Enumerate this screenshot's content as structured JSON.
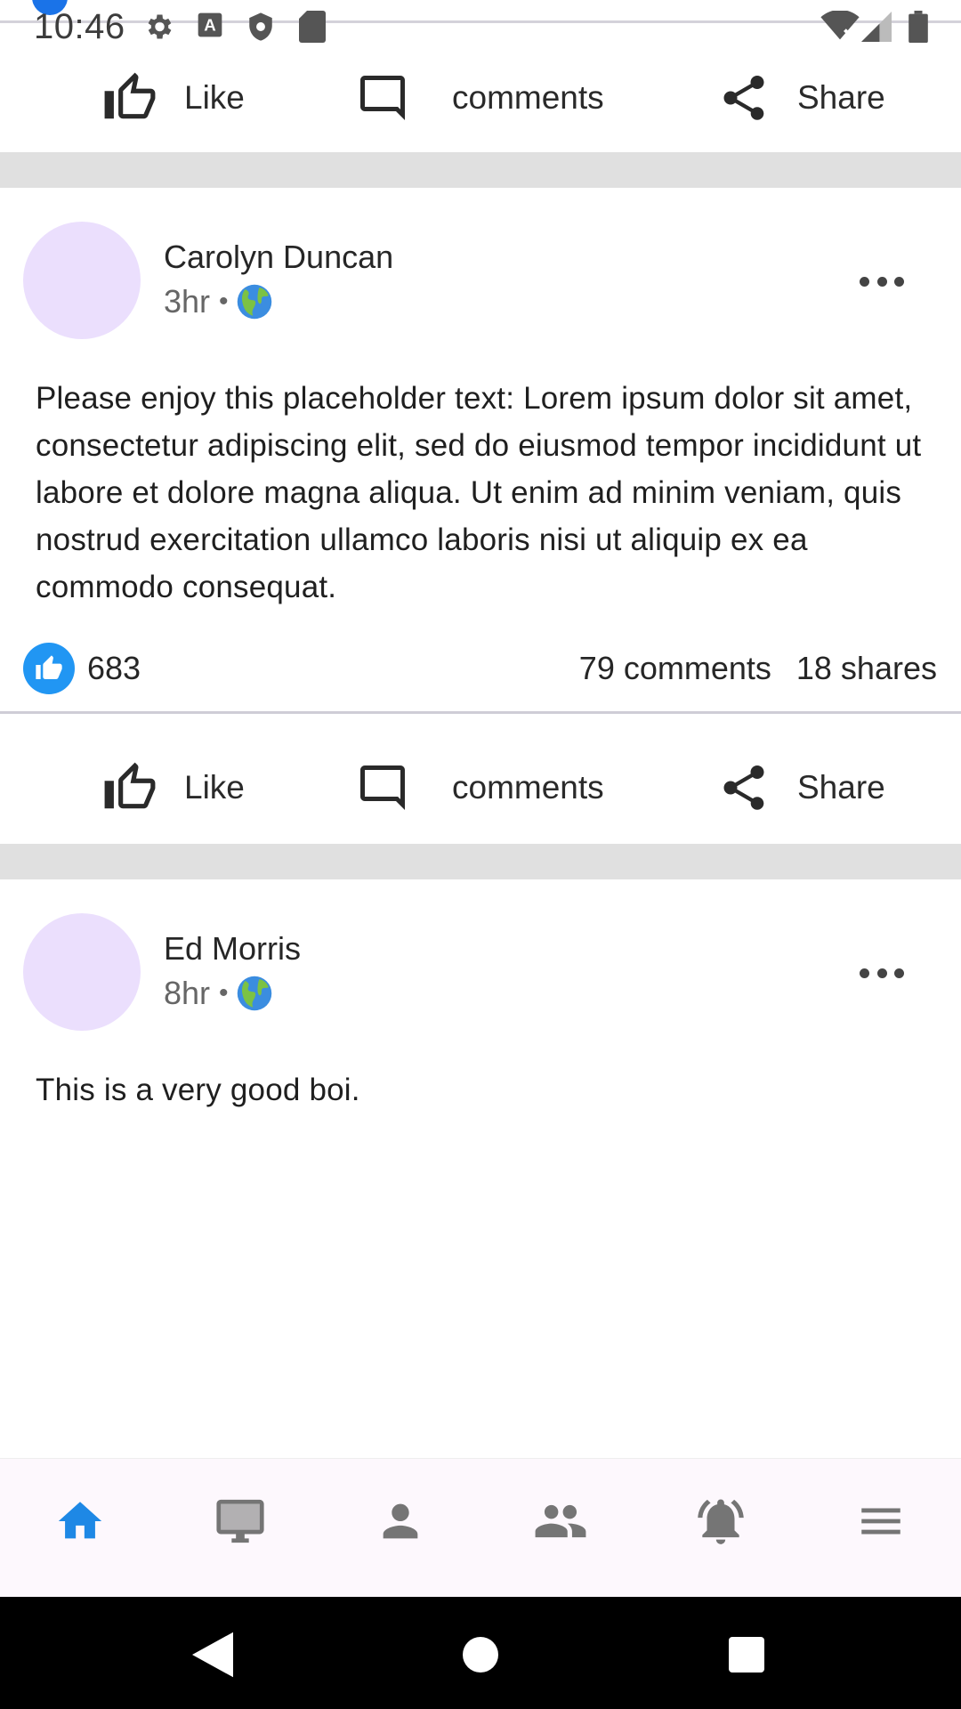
{
  "status_bar": {
    "time": "10:46",
    "left_icons": [
      "settings-icon",
      "text-a-icon",
      "shield-icon",
      "sd-card-icon"
    ],
    "right_icons": [
      "wifi-off-icon",
      "signal-icon",
      "battery-icon"
    ]
  },
  "actions": {
    "like_label": "Like",
    "comments_label": "comments",
    "share_label": "Share"
  },
  "posts": [
    {
      "author": "Carolyn Duncan",
      "time": "3hr",
      "text": "Please enjoy this placeholder text: Lorem ipsum dolor sit amet, consectetur adipiscing elit, sed do eiusmod tempor incididunt ut labore et dolore magna aliqua. Ut enim ad minim veniam, quis nostrud exercitation ullamco laboris nisi ut aliquip ex ea commodo consequat.",
      "likes": "683",
      "comments": "79 comments",
      "shares": "18 shares"
    },
    {
      "author": "Ed Morris",
      "time": "8hr",
      "text": "This is a very good boi."
    }
  ],
  "bottom_nav": {
    "items": [
      "home-icon",
      "tv-icon",
      "person-icon",
      "groups-icon",
      "notifications-icon",
      "menu-icon"
    ],
    "active_item": "home-icon",
    "active_color": "#1e88e5",
    "inactive_color": "#757575"
  },
  "colors": {
    "avatar_bg": "#ebdffd",
    "like_badge": "#2196f3",
    "separator": "#e0e0e0"
  }
}
